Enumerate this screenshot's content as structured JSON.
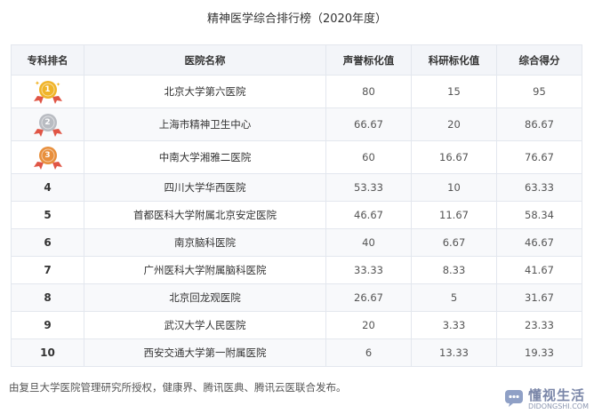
{
  "title": "精神医学综合排行榜（2020年度）",
  "table": {
    "headers": [
      "专科排名",
      "医院名称",
      "声誉标化值",
      "科研标化值",
      "综合得分"
    ],
    "rows": [
      {
        "rank": "1",
        "name": "北京大学第六医院",
        "reputation": "80",
        "research": "15",
        "total": "95",
        "medal": "gold"
      },
      {
        "rank": "2",
        "name": "上海市精神卫生中心",
        "reputation": "66.67",
        "research": "20",
        "total": "86.67",
        "medal": "silver"
      },
      {
        "rank": "3",
        "name": "中南大学湘雅二医院",
        "reputation": "60",
        "research": "16.67",
        "total": "76.67",
        "medal": "bronze"
      },
      {
        "rank": "4",
        "name": "四川大学华西医院",
        "reputation": "53.33",
        "research": "10",
        "total": "63.33"
      },
      {
        "rank": "5",
        "name": "首都医科大学附属北京安定医院",
        "reputation": "46.67",
        "research": "11.67",
        "total": "58.34"
      },
      {
        "rank": "6",
        "name": "南京脑科医院",
        "reputation": "40",
        "research": "6.67",
        "total": "46.67"
      },
      {
        "rank": "7",
        "name": "广州医科大学附属脑科医院",
        "reputation": "33.33",
        "research": "8.33",
        "total": "41.67"
      },
      {
        "rank": "8",
        "name": "北京回龙观医院",
        "reputation": "26.67",
        "research": "5",
        "total": "31.67"
      },
      {
        "rank": "9",
        "name": "武汉大学人民医院",
        "reputation": "20",
        "research": "3.33",
        "total": "23.33"
      },
      {
        "rank": "10",
        "name": "西安交通大学第一附属医院",
        "reputation": "6",
        "research": "13.33",
        "total": "19.33"
      }
    ]
  },
  "colors": {
    "gold": "#f0b429",
    "silver": "#b9bcc2",
    "bronze": "#e88f3c",
    "ribbon": "#e05545"
  },
  "footer": "由复旦大学医院管理研究所授权，健康界、腾讯医典、腾讯云医联合发布。",
  "watermark": {
    "main": "懂视生活",
    "sub": "DIDONGSHI.COM",
    "icon": "chat-bubble-icon"
  }
}
